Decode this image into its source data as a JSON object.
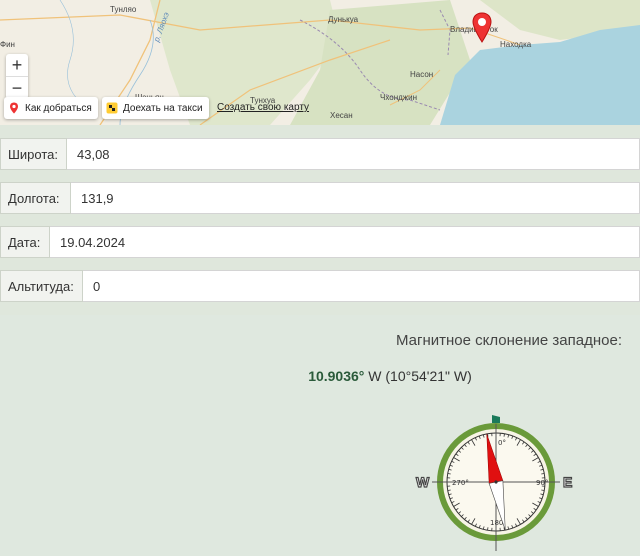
{
  "map": {
    "labels": {
      "tunlyao": "Тунляо",
      "dunkhua": "Дунькуа",
      "vladivostok": "Владивосток",
      "nakhodka": "Находка",
      "nason": "Насон",
      "chkhondzhin": "Чхонджин",
      "khesan": "Хесан",
      "shenyan": "Шэньян",
      "tunkhua": "Тунхуа",
      "river": "р. Ляохэ",
      "fin": "Фин"
    },
    "zoom_in": "+",
    "zoom_out": "−",
    "route_button": "Как добраться",
    "taxi_button": "Доехать на такси",
    "create_map_link": "Создать свою карту"
  },
  "form": {
    "latitude": {
      "label": "Широта:",
      "value": "43,08"
    },
    "longitude": {
      "label": "Долгота:",
      "value": "131,9"
    },
    "date": {
      "label": "Дата:",
      "value": "19.04.2024"
    },
    "altitude": {
      "label": "Альтитуда:",
      "value": "0"
    }
  },
  "result": {
    "title": "Магнитное склонение западное:",
    "value_num": "10.9036°",
    "value_rest": " W (10°54'21\" W)",
    "declination_deg": -10.9036
  },
  "compass": {
    "w": "W",
    "e": "E",
    "deg0": "0°",
    "deg90": "90°",
    "deg180": "180",
    "deg270": "270°",
    "ring_color": "#6a9a3a",
    "needle_color": "#e01010"
  }
}
